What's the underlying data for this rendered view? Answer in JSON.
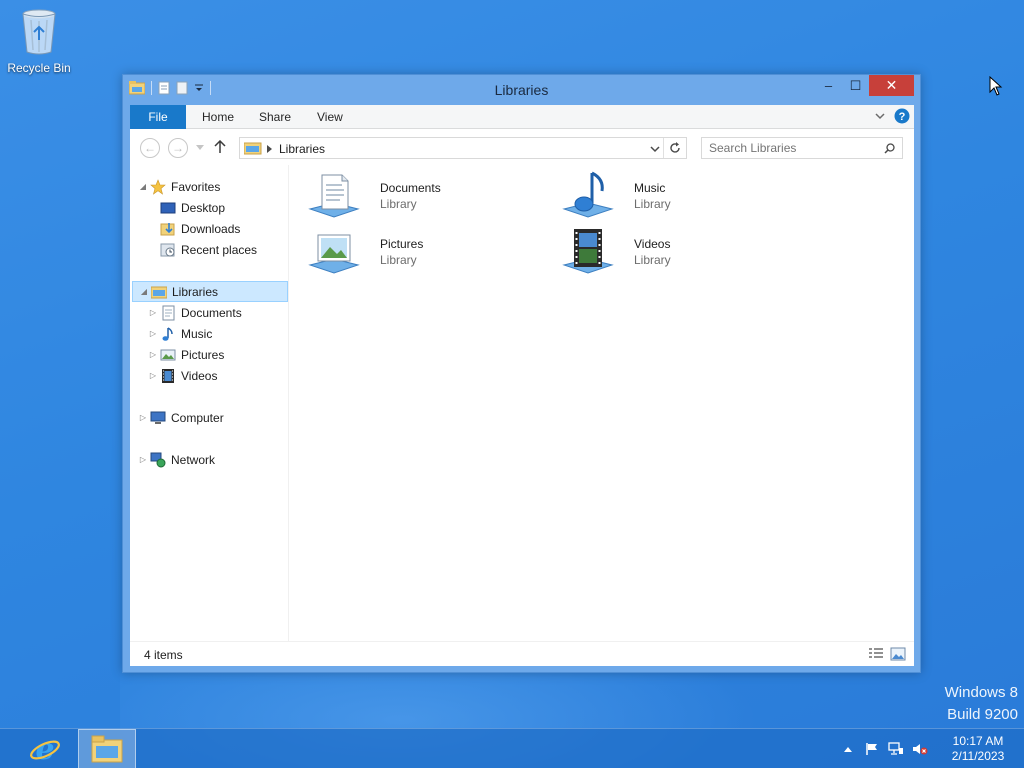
{
  "desktop": {
    "recycle_bin_label": "Recycle Bin",
    "watermark_line1": "Windows 8",
    "watermark_line2": "Build 9200"
  },
  "window": {
    "title": "Libraries",
    "controls": {
      "minimize": "–",
      "maximize": "☐",
      "close": "✕"
    }
  },
  "ribbon": {
    "tabs": [
      {
        "label": "File"
      },
      {
        "label": "Home"
      },
      {
        "label": "Share"
      },
      {
        "label": "View"
      }
    ]
  },
  "address": {
    "crumb": "Libraries",
    "search_placeholder": "Search Libraries"
  },
  "nav": {
    "favorites": {
      "label": "Favorites",
      "items": [
        "Desktop",
        "Downloads",
        "Recent places"
      ]
    },
    "libraries": {
      "label": "Libraries",
      "items": [
        "Documents",
        "Music",
        "Pictures",
        "Videos"
      ]
    },
    "computer": "Computer",
    "network": "Network"
  },
  "main": {
    "tiles": [
      {
        "name": "Documents",
        "type": "Library",
        "icon": "documents-library-icon"
      },
      {
        "name": "Music",
        "type": "Library",
        "icon": "music-library-icon"
      },
      {
        "name": "Pictures",
        "type": "Library",
        "icon": "pictures-library-icon"
      },
      {
        "name": "Videos",
        "type": "Library",
        "icon": "videos-library-icon"
      }
    ]
  },
  "status": {
    "item_count": "4 items"
  },
  "taskbar": {
    "time": "10:17 AM",
    "date": "2/11/2023",
    "tray_icons": [
      "show-hidden-icons",
      "action-center-flag-icon",
      "network-icon",
      "volume-muted-icon"
    ]
  },
  "colors": {
    "accent": "#1979ca",
    "selection": "#cce8ff",
    "close_button": "#c7403a"
  }
}
